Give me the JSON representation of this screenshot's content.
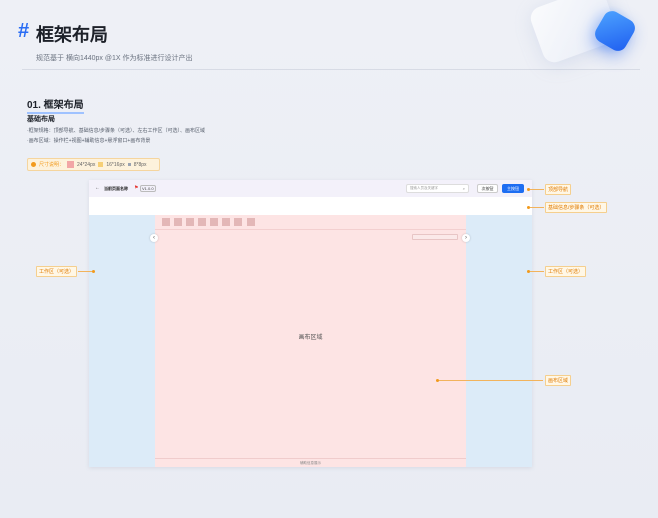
{
  "header": {
    "hash": "#",
    "title": "框架布局",
    "subtitle": "规范基于 横向1440px @1X 作为标准进行设计产出"
  },
  "section": {
    "title": "01. 框架布局",
    "subtitle": "基础布局",
    "desc1": "·框架规格：顶部导航、基础信息/步骤条（可选）、左右工作区（可选）、画布区域",
    "desc2": "·画布区域：操作栏+视图+辅助信息+悬浮窗口+画布背景"
  },
  "spec": {
    "label": "尺寸说明：",
    "s24": "24*24px",
    "s16": "16*16px",
    "s8": "8*8px"
  },
  "topbar": {
    "back": "←",
    "name": "当前页面名称",
    "flag": "⚑",
    "version": "V1.0.0",
    "search_placeholder": "搜索人员及关键字",
    "btn_secondary": "次按钮",
    "btn_primary": "主按钮"
  },
  "canvas": {
    "label": "画布区域",
    "bottom": "辅助信息展示",
    "arrow_left": "‹",
    "arrow_right": "›"
  },
  "annotations": {
    "top_nav": "顶部导航",
    "info_bar": "基础信息/步骤条（可选）",
    "work_left": "工作区（可选）",
    "work_right": "工作区（可选）",
    "canvas_area": "画布区域"
  },
  "colors": {
    "primary": "#1e6ef2",
    "accent": "#f29a1c",
    "work_area": "#dcebf8",
    "canvas": "#fde4e4"
  }
}
